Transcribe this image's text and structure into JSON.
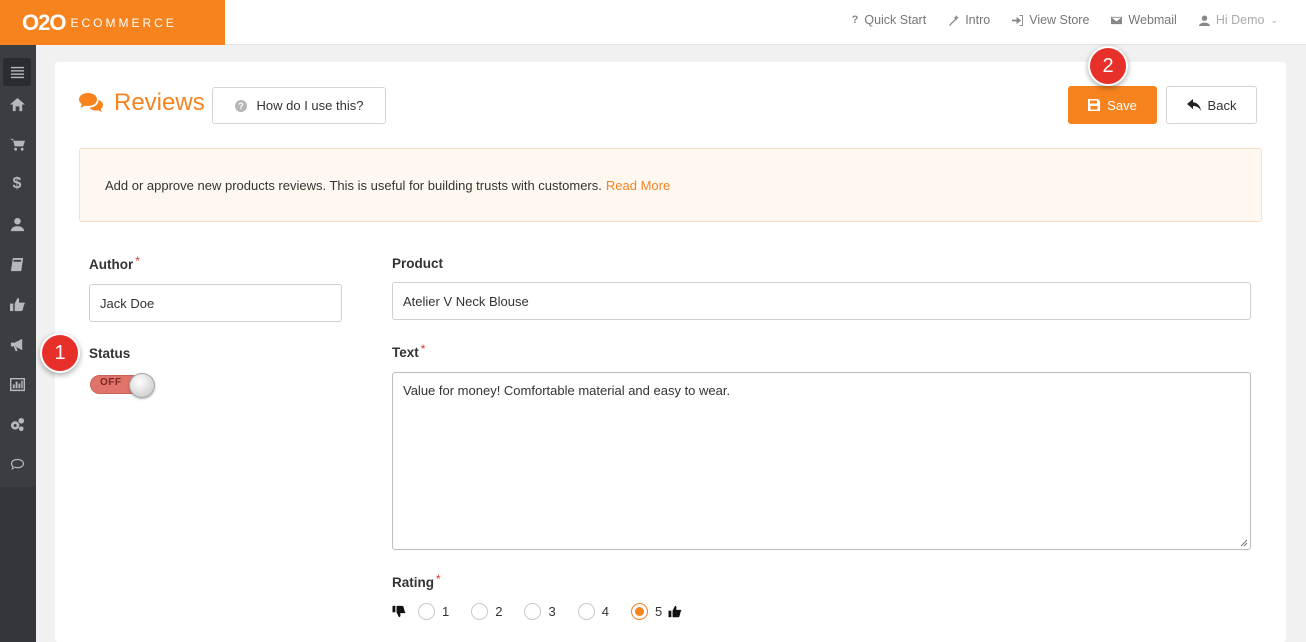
{
  "brand": {
    "mark": "O2O",
    "text": "ECOMMERCE"
  },
  "topnav": {
    "quick_start": "Quick Start",
    "intro": "Intro",
    "view_store": "View Store",
    "webmail": "Webmail",
    "user": "Hi Demo"
  },
  "sidebar": {
    "icons": [
      "menu-icon",
      "home-icon",
      "cart-icon",
      "dollar-icon",
      "user-icon",
      "book-icon",
      "thumbs-up-icon",
      "megaphone-icon",
      "chart-icon",
      "gears-icon",
      "chat-icon"
    ]
  },
  "page": {
    "title": "Reviews",
    "help_label": "How do I use this?",
    "save_label": "Save",
    "back_label": "Back"
  },
  "notice": {
    "text": "Add or approve new products reviews. This is useful for building trusts with customers.",
    "link": "Read More"
  },
  "form": {
    "author_label": "Author",
    "author_value": "Jack Doe",
    "required_mark": "*",
    "status_label": "Status",
    "status_value": "OFF",
    "product_label": "Product",
    "product_value": "Atelier V Neck Blouse",
    "text_label": "Text",
    "text_value": "Value for money! Comfortable material and easy to wear.",
    "rating_label": "Rating",
    "rating_options": [
      "1",
      "2",
      "3",
      "4",
      "5"
    ],
    "rating_selected": "5"
  },
  "callouts": {
    "one": "1",
    "two": "2"
  },
  "colors": {
    "accent": "#f7831e",
    "sidebar": "#3a3d42",
    "callout": "#e8302a",
    "toggle_off": "#e0736a"
  }
}
